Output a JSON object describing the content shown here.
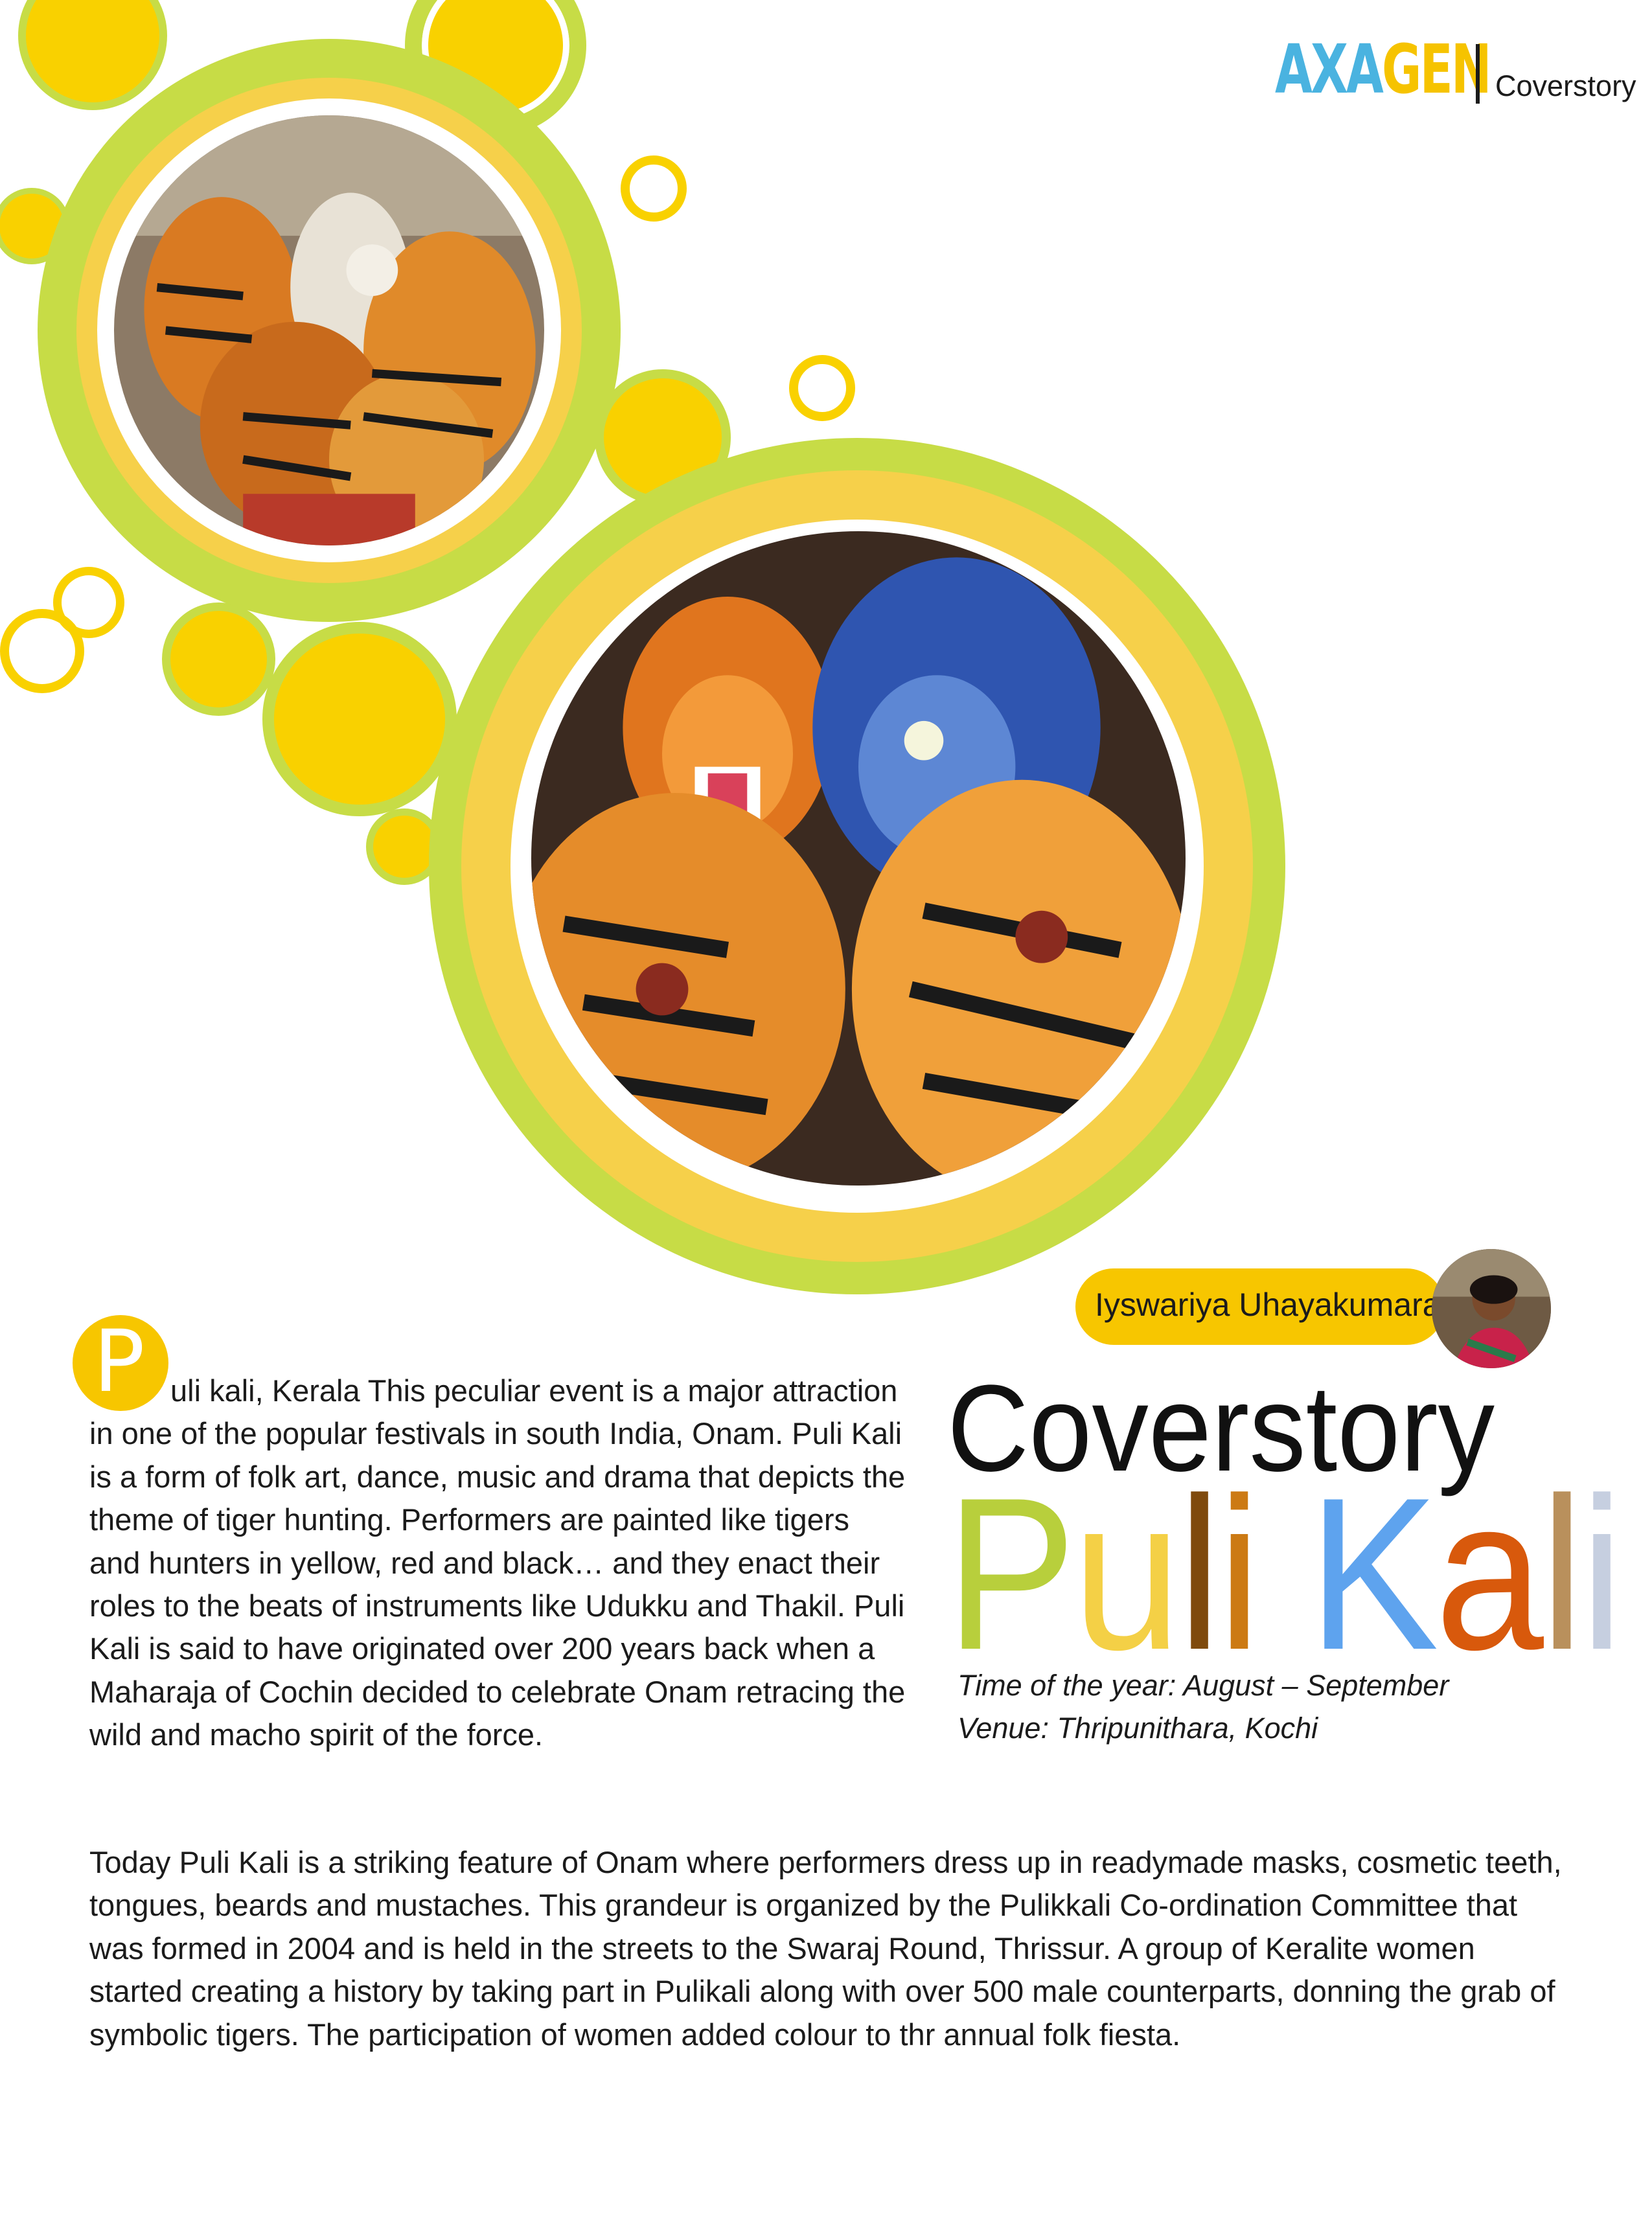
{
  "header": {
    "brand_part1": "AXA",
    "brand_part2": "GEN",
    "section": "Coverstory"
  },
  "photos": {
    "top": "tiger-dance-crowd-photo",
    "main": "tiger-masked-performers-photo"
  },
  "author": {
    "name": "Iyswariya Uhayakumaran"
  },
  "article": {
    "kicker": "Coverstory",
    "headline_letters": [
      {
        "char": "P",
        "color": "#b8cf3c"
      },
      {
        "char": "u",
        "color": "#f4d046"
      },
      {
        "char": "l",
        "color": "#7f4a0d"
      },
      {
        "char": "i",
        "color": "#cc7a14"
      },
      {
        "char": " ",
        "color": "#ffffff"
      },
      {
        "char": "K",
        "color": "#5ea3ee"
      },
      {
        "char": "a",
        "color": "#d8590c"
      },
      {
        "char": "l",
        "color": "#b9905c"
      },
      {
        "char": "i",
        "color": "#c6cfe0"
      }
    ],
    "time_of_year": "Time of the year: August – September",
    "venue": "Venue: Thripunithara, Kochi",
    "dropcap": "P",
    "paragraph1": "uli kali,  Kerala This peculiar event is a major attraction in one of the popular festivals in south India, Onam. Puli Kali is a form of folk art, dance, music and drama that depicts the theme of tiger hunting. Performers are painted like tigers and hunters in yellow, red and black… and they enact their roles to the beats of instruments like Udukku and Thakil.  Puli Kali is said to have originated over 200 years back when a Maharaja of Cochin decided to celebrate Onam retracing the wild and macho spirit of the force.",
    "paragraph2": "Today Puli Kali is a striking feature of Onam where performers dress up in readymade masks, cosmetic teeth, tongues, beards and mustaches. This grandeur is organized by the Pulikkali Co-ordination Committee that was formed in 2004 and is held in the streets to the Swaraj Round, Thrissur. A group of Keralite women started creating a history by taking part in Pulikali along with over 500 male counterparts, donning the grab of symbolic tigers. The participation of women added colour to thr annual folk fiesta."
  },
  "colors": {
    "accent_yellow": "#f7c600",
    "accent_green": "#c2d840",
    "accent_blue": "#4ab3e0"
  }
}
